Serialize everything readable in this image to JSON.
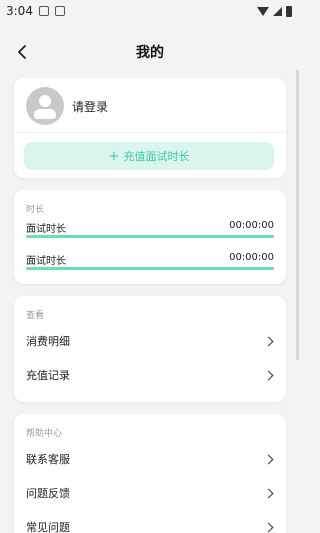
{
  "status_bar": {
    "time": "3:04"
  },
  "header": {
    "title": "我的"
  },
  "profile": {
    "login_text": "请登录",
    "recharge_label": "充值面试时长"
  },
  "time_section": {
    "label": "时长",
    "rows": [
      {
        "name": "面试时长",
        "value": "00:00:00",
        "progress": 1.0
      },
      {
        "name": "面试时长",
        "value": "00:00:00",
        "progress": 1.0
      }
    ]
  },
  "view_section": {
    "label": "查看",
    "items": [
      {
        "label": "消费明细"
      },
      {
        "label": "充值记录"
      }
    ]
  },
  "help_section": {
    "label": "帮助中心",
    "items": [
      {
        "label": "联系客服"
      },
      {
        "label": "问题反馈"
      },
      {
        "label": "常见问题"
      }
    ]
  },
  "colors": {
    "accent": "#3cc9a3",
    "accent_bg": "#d9f5ee",
    "progress": "#68dcbd",
    "page_bg": "#f2f4f3"
  }
}
